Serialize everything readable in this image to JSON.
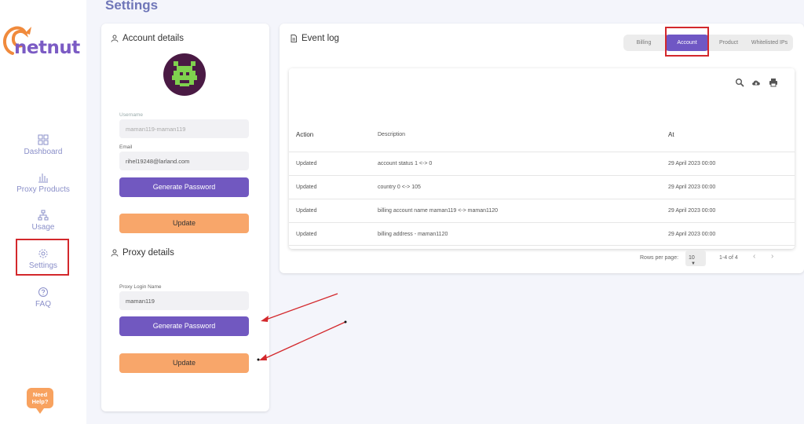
{
  "brand": {
    "name": "netnut",
    "color": "#7b5bc4",
    "accent": "#f08a3c"
  },
  "page": {
    "title": "Settings"
  },
  "sidebar": {
    "items": [
      {
        "label": "Dashboard",
        "icon": "dashboard-icon"
      },
      {
        "label": "Proxy Products",
        "icon": "bar-chart-icon"
      },
      {
        "label": "Usage",
        "icon": "hierarchy-icon"
      },
      {
        "label": "Settings",
        "icon": "gear-icon",
        "active": true
      },
      {
        "label": "FAQ",
        "icon": "help-circle-icon"
      }
    ],
    "help_line1": "Need",
    "help_line2": "Help?"
  },
  "account": {
    "title": "Account details",
    "username_label": "Username",
    "username_value": "maman119-maman119",
    "email_label": "Email",
    "email_value": "rihel19248@larland.com",
    "generate_label": "Generate Password",
    "update_label": "Update"
  },
  "proxy": {
    "title": "Proxy details",
    "login_label": "Proxy Login Name",
    "login_value": "maman119",
    "generate_label": "Generate Password",
    "update_label": "Update"
  },
  "eventlog": {
    "title": "Event log",
    "tabs": [
      "Billing",
      "Account",
      "Product",
      "Whitelisted IPs"
    ],
    "active_tab": "Account",
    "columns": [
      "Action",
      "Description",
      "At"
    ],
    "rows": [
      {
        "action": "Updated",
        "description": "account status 1 <-> 0",
        "at": "29 April 2023 00:00"
      },
      {
        "action": "Updated",
        "description": "country 0 <-> 105",
        "at": "29 April 2023 00:00"
      },
      {
        "action": "Updated",
        "description": "billing account name maman119 <-> maman1120",
        "at": "29 April 2023 00:00"
      },
      {
        "action": "Updated",
        "description": "billing address - maman1120",
        "at": "29 April 2023 00:00"
      }
    ],
    "rows_per_page_label": "Rows per page:",
    "rows_per_page": "10",
    "range": "1-4 of 4"
  },
  "colors": {
    "primary": "#7158c0",
    "orange": "#f8a66a",
    "highlight": "#d3282c"
  }
}
